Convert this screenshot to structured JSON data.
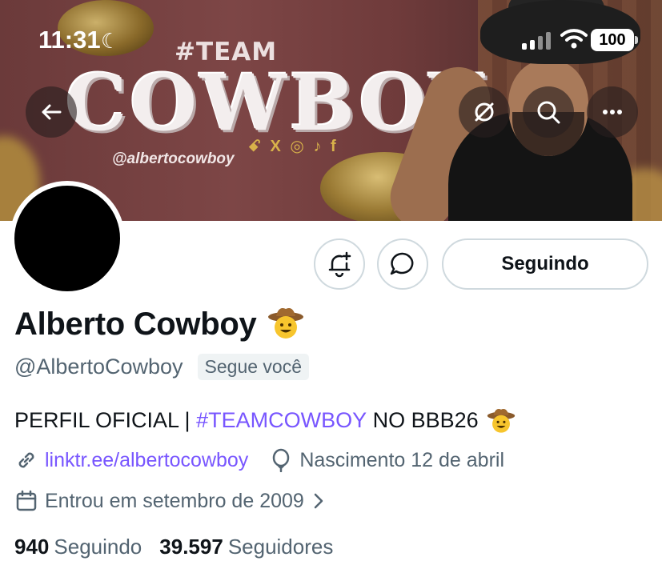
{
  "status_bar": {
    "time": "11:31",
    "battery": "100"
  },
  "banner": {
    "team_text": "#TEAM",
    "big_text": "COWBOY",
    "handle": "@albertocowboy",
    "socials": "ꗃ X ◎ ♪ f"
  },
  "top_buttons": {
    "back_icon": "back-arrow-icon",
    "grok_icon": "grok-icon",
    "search_icon": "search-icon",
    "more_icon": "more-icon"
  },
  "actions": {
    "follow_label": "Seguindo"
  },
  "profile": {
    "name": "Alberto Cowboy",
    "handle": "@AlbertoCowboy",
    "follows_you": "Segue você",
    "bio_prefix": "PERFIL OFICIAL | ",
    "bio_tag": "#TEAMCOWBOY",
    "bio_suffix": " NO BBB26",
    "link": "linktr.ee/albertocowboy",
    "birthday": "Nascimento 12 de abril",
    "joined": "Entrou em setembro de 2009"
  },
  "stats": {
    "following_count": "940",
    "following_label": "Seguindo",
    "followers_count": "39.597",
    "followers_label": "Seguidores"
  },
  "colors": {
    "accent": "#7856ff",
    "secondary_text": "#536471",
    "border": "#cfd9de"
  }
}
